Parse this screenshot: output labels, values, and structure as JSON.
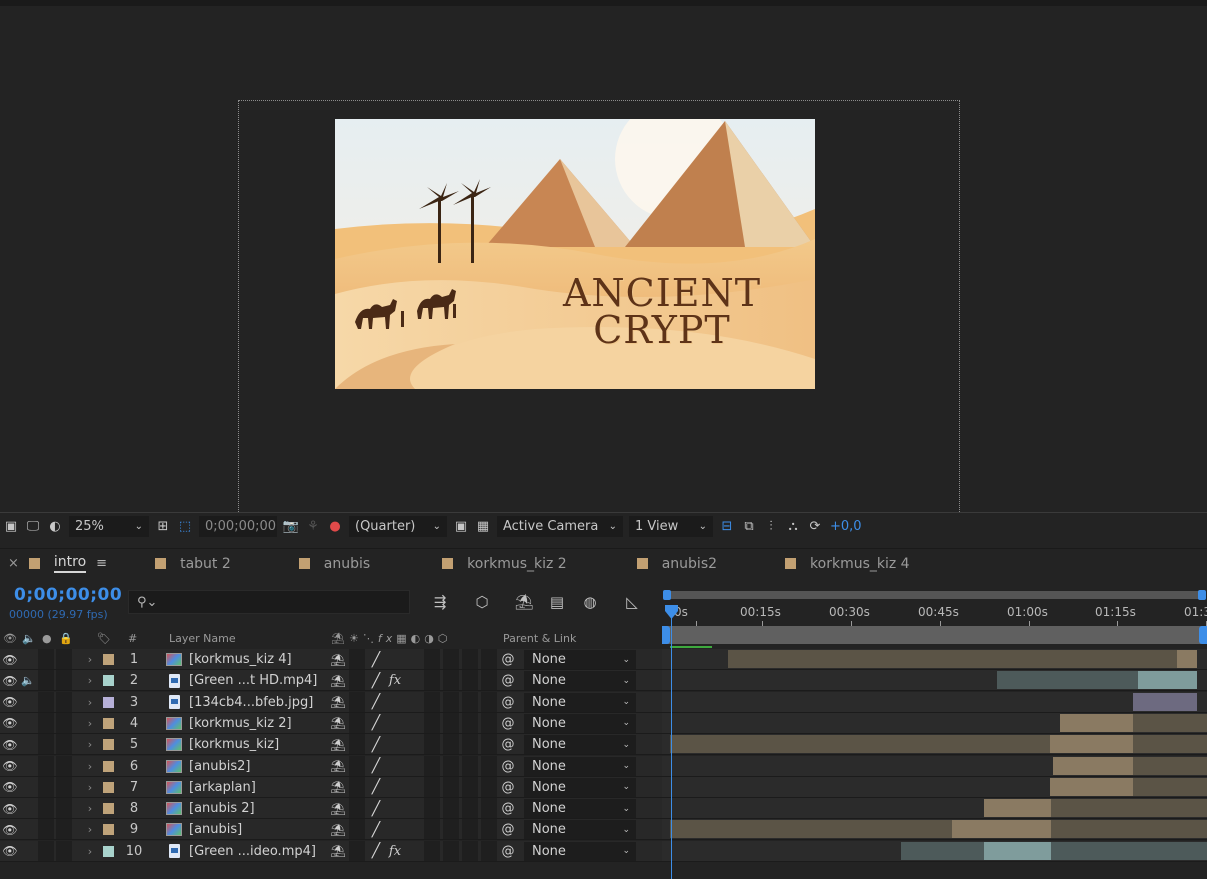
{
  "composition": {
    "title_line1": "ANCIENT",
    "title_line2": "CRYPT"
  },
  "viewer_toolbar": {
    "zoom": "25%",
    "timecode": "0;00;00;00",
    "resolution": "(Quarter)",
    "camera": "Active Camera",
    "views": "1 View",
    "exposure": "+0,0"
  },
  "tabs": [
    {
      "label": "intro",
      "active": true
    },
    {
      "label": "tabut 2"
    },
    {
      "label": "anubis"
    },
    {
      "label": "korkmus_kiz 2"
    },
    {
      "label": "anubis2"
    },
    {
      "label": "korkmus_kiz 4"
    }
  ],
  "timeline": {
    "current_time": "0;00;00;00",
    "frame_info": "00000 (29.97 fps)",
    "search_placeholder": "",
    "column_hash": "#",
    "column_layer_name": "Layer Name",
    "column_parent": "Parent & Link",
    "ruler_labels": [
      "0s",
      "00:15s",
      "00:30s",
      "00:45s",
      "01:00s",
      "01:15s",
      "01:3"
    ]
  },
  "layers": [
    {
      "num": "1",
      "name": "[korkmus_kiz 4]",
      "type": "comp",
      "label_color": "#bfa37a",
      "audio": false,
      "fx": false,
      "parent": "None"
    },
    {
      "num": "2",
      "name": "[Green ...t HD.mp4]",
      "type": "video",
      "label_color": "#a8d2cc",
      "audio": true,
      "fx": true,
      "parent": "None"
    },
    {
      "num": "3",
      "name": "[134cb4...bfeb.jpg]",
      "type": "image",
      "label_color": "#b6b0d8",
      "audio": false,
      "fx": false,
      "parent": "None"
    },
    {
      "num": "4",
      "name": "[korkmus_kiz 2]",
      "type": "comp",
      "label_color": "#bfa37a",
      "audio": false,
      "fx": false,
      "parent": "None"
    },
    {
      "num": "5",
      "name": "[korkmus_kiz]",
      "type": "comp",
      "label_color": "#bfa37a",
      "audio": false,
      "fx": false,
      "parent": "None"
    },
    {
      "num": "6",
      "name": "[anubis2]",
      "type": "comp",
      "label_color": "#bfa37a",
      "audio": false,
      "fx": false,
      "parent": "None"
    },
    {
      "num": "7",
      "name": "[arkaplan]",
      "type": "comp",
      "label_color": "#bfa37a",
      "audio": false,
      "fx": false,
      "parent": "None"
    },
    {
      "num": "8",
      "name": "[anubis 2]",
      "type": "comp",
      "label_color": "#bfa37a",
      "audio": false,
      "fx": false,
      "parent": "None"
    },
    {
      "num": "9",
      "name": "[anubis]",
      "type": "comp",
      "label_color": "#bfa37a",
      "audio": false,
      "fx": false,
      "parent": "None"
    },
    {
      "num": "10",
      "name": "[Green ...ideo.mp4]",
      "type": "video",
      "label_color": "#a8d2cc",
      "audio": false,
      "fx": true,
      "parent": "None"
    }
  ],
  "colors": {
    "accent_blue": "#3d8ee8",
    "comp_bar": "#5b5446",
    "comp_bar_active": "#8a7a62",
    "video_bar": "#4d5a5a",
    "video_bar_active": "#7f9c9c",
    "image_bar": "#6d6a80"
  }
}
